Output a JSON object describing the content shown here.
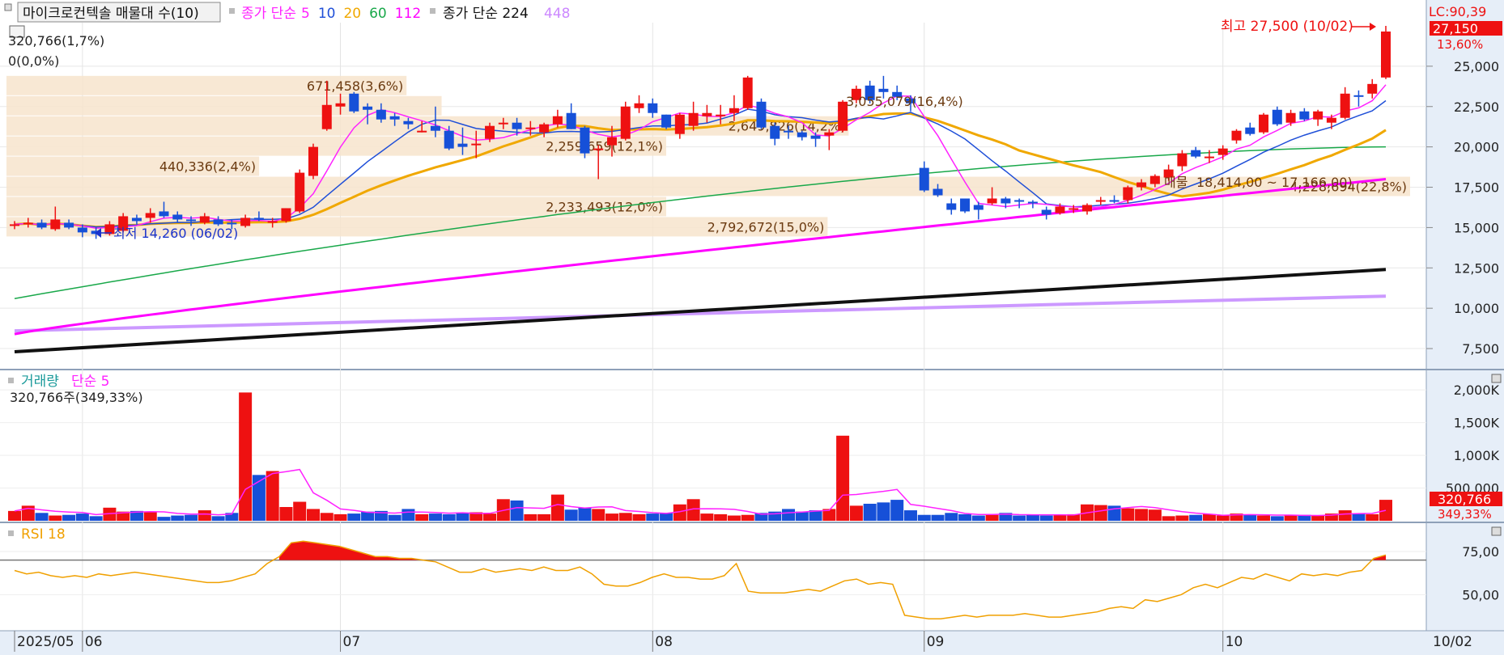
{
  "header": {
    "title": "마이크로컨텍솔 매물대 수(10)",
    "ma_label": "종가 단순",
    "ma_periods": [
      {
        "p": "5",
        "color": "#ff22ff"
      },
      {
        "p": "10",
        "color": "#1f4fd8"
      },
      {
        "p": "20",
        "color": "#f0a800"
      },
      {
        "p": "60",
        "color": "#19a84a"
      },
      {
        "p": "112",
        "color": "#ff00ff"
      }
    ],
    "ma2_label": "종가 단순 224",
    "ma2_extra": "448"
  },
  "price_panel": {
    "right_badges": {
      "lc": "LC:90,39",
      "last": "27,150",
      "pct": "13,60%"
    },
    "high_label": "최고 27,500 (10/02)",
    "low_label": "최저 14,260 (06/02)",
    "first_zone_labels": [
      "320,766(1,7%)",
      "0(0,0%)"
    ],
    "y_ticks": [
      {
        "v": 25000,
        "label": "25,000"
      },
      {
        "v": 22500,
        "label": "22,500"
      },
      {
        "v": 20000,
        "label": "20,000"
      },
      {
        "v": 17500,
        "label": "17,500"
      },
      {
        "v": 15000,
        "label": "15,000"
      },
      {
        "v": 12500,
        "label": "12,500"
      },
      {
        "v": 10000,
        "label": "10,000"
      },
      {
        "v": 7500,
        "label": "7,500"
      }
    ],
    "volume_zones": [
      {
        "lo": 23200,
        "hi": 24400,
        "len": 0.285,
        "label": "671,458(3,6%)"
      },
      {
        "lo": 21950,
        "hi": 23150,
        "len": 0.31,
        "label": ""
      },
      {
        "lo": 20700,
        "hi": 21900,
        "len": 0.6,
        "label": "2,649,826(14,2%)"
      },
      {
        "lo": 19450,
        "hi": 20650,
        "len": 0.47,
        "label": "2,259,659(12,1%)"
      },
      {
        "lo": 18200,
        "hi": 19400,
        "len": 0.18,
        "label": "440,336(2,4%)"
      },
      {
        "lo": 16950,
        "hi": 18150,
        "len": 1.0,
        "label": "4,228,694(22,8%)"
      },
      {
        "lo": 15700,
        "hi": 16900,
        "len": 0.47,
        "label": "2,233,493(12,0%)"
      },
      {
        "lo": 14450,
        "hi": 15650,
        "len": 0.585,
        "label": "2,792,672(15,0%)"
      }
    ],
    "zone_top_label": "3,055,079(16,4%)",
    "zone_top_value": 22800,
    "range_label": "18,414,00 ~ 17,166,00)",
    "range_prefix": "매물"
  },
  "x_axis": {
    "labels": [
      {
        "i": 0,
        "label": "2025/05"
      },
      {
        "i": 5,
        "label": "06"
      },
      {
        "i": 24,
        "label": "07"
      },
      {
        "i": 47,
        "label": "08"
      },
      {
        "i": 67,
        "label": "09"
      },
      {
        "i": 89,
        "label": "10"
      }
    ],
    "right_label": "10/02"
  },
  "volume_panel": {
    "title": "거래량",
    "ma_label": "단순 5",
    "value_label": "320,766주(349,33%)",
    "badge_value": "320,766",
    "badge_pct": "349,33%",
    "y_ticks": [
      {
        "v": 2000000,
        "label": "2,000K"
      },
      {
        "v": 1500000,
        "label": "1,500K"
      },
      {
        "v": 1000000,
        "label": "1,000K"
      },
      {
        "v": 500000,
        "label": "500,000"
      }
    ]
  },
  "rsi_panel": {
    "title": "RSI 18",
    "threshold": 70,
    "y_ticks": [
      {
        "v": 75,
        "label": "75,00"
      },
      {
        "v": 50,
        "label": "50,00"
      }
    ]
  },
  "chart_data": {
    "type": "candlestick",
    "title": "마이크로컨텍솔 매물대 수(10)",
    "ylim": [
      6300,
      27600
    ],
    "ohlc": [
      [
        15100,
        15400,
        14900,
        15200
      ],
      [
        15200,
        15600,
        15000,
        15300
      ],
      [
        15300,
        15500,
        14900,
        15000
      ],
      [
        14900,
        16300,
        14800,
        15500
      ],
      [
        15300,
        15500,
        14900,
        15000
      ],
      [
        15000,
        15200,
        14400,
        14700
      ],
      [
        14800,
        15000,
        14300,
        14600
      ],
      [
        14600,
        15400,
        14500,
        15200
      ],
      [
        14800,
        15900,
        14700,
        15700
      ],
      [
        15600,
        15800,
        15200,
        15400
      ],
      [
        15600,
        16200,
        15300,
        15900
      ],
      [
        16000,
        16600,
        15600,
        15700
      ],
      [
        15800,
        16000,
        15300,
        15500
      ],
      [
        15500,
        15700,
        15100,
        15400
      ],
      [
        15300,
        15900,
        15200,
        15700
      ],
      [
        15500,
        15700,
        15100,
        15200
      ],
      [
        15300,
        15500,
        14900,
        15200
      ],
      [
        15100,
        15800,
        15000,
        15600
      ],
      [
        15600,
        16000,
        15400,
        15500
      ],
      [
        15300,
        15600,
        15000,
        15400
      ],
      [
        15400,
        16200,
        15300,
        16200
      ],
      [
        16000,
        18600,
        15900,
        18400
      ],
      [
        18200,
        20200,
        18000,
        20000
      ],
      [
        21100,
        24100,
        21000,
        22600
      ],
      [
        22500,
        23300,
        22000,
        22700
      ],
      [
        23300,
        23400,
        22100,
        22200
      ],
      [
        22500,
        22700,
        21400,
        22300
      ],
      [
        22300,
        22700,
        21500,
        21700
      ],
      [
        21900,
        22100,
        21300,
        21700
      ],
      [
        21600,
        21800,
        21100,
        21400
      ],
      [
        21000,
        21600,
        20900,
        21000
      ],
      [
        21300,
        22500,
        20600,
        21000
      ],
      [
        21000,
        21300,
        19800,
        19900
      ],
      [
        20200,
        21200,
        19500,
        20000
      ],
      [
        20200,
        21000,
        19300,
        20200
      ],
      [
        20500,
        21500,
        20300,
        21300
      ],
      [
        21500,
        21800,
        21100,
        21500
      ],
      [
        21500,
        21800,
        20700,
        21100
      ],
      [
        21100,
        21600,
        20700,
        21200
      ],
      [
        20900,
        21500,
        20600,
        21400
      ],
      [
        21400,
        22300,
        21200,
        21900
      ],
      [
        22100,
        22700,
        21100,
        21100
      ],
      [
        21200,
        21300,
        19300,
        19600
      ],
      [
        19800,
        20100,
        18000,
        19900
      ],
      [
        20100,
        21300,
        19400,
        20600
      ],
      [
        20500,
        22800,
        20400,
        22500
      ],
      [
        22400,
        23200,
        22100,
        22700
      ],
      [
        22700,
        23000,
        21800,
        22100
      ],
      [
        22000,
        22000,
        21100,
        21200
      ],
      [
        20800,
        22100,
        20500,
        22000
      ],
      [
        21300,
        22800,
        21000,
        22100
      ],
      [
        21900,
        22600,
        21500,
        22100
      ],
      [
        21900,
        22600,
        21400,
        22000
      ],
      [
        22100,
        23200,
        21600,
        22400
      ],
      [
        22400,
        24400,
        22300,
        24300
      ],
      [
        22800,
        23000,
        21100,
        21200
      ],
      [
        21300,
        21500,
        20100,
        20500
      ],
      [
        21000,
        21300,
        20500,
        20900
      ],
      [
        20900,
        21000,
        20400,
        20600
      ],
      [
        20700,
        20900,
        20000,
        20500
      ],
      [
        20700,
        21100,
        19800,
        20900
      ],
      [
        21000,
        22900,
        20900,
        22800
      ],
      [
        22900,
        23800,
        22700,
        23600
      ],
      [
        23800,
        24100,
        22700,
        22900
      ],
      [
        23600,
        24400,
        23000,
        23400
      ],
      [
        23400,
        23800,
        22900,
        23100
      ],
      [
        23000,
        23200,
        22200,
        22700
      ],
      [
        18700,
        19100,
        17200,
        17300
      ],
      [
        17400,
        17700,
        16900,
        17000
      ],
      [
        16500,
        16800,
        15800,
        16100
      ],
      [
        16800,
        16800,
        15900,
        16000
      ],
      [
        16400,
        16600,
        15500,
        16100
      ],
      [
        16500,
        17500,
        16400,
        16800
      ],
      [
        16800,
        16900,
        16200,
        16500
      ],
      [
        16700,
        16800,
        16200,
        16600
      ],
      [
        16600,
        16700,
        16200,
        16500
      ],
      [
        16100,
        16300,
        15500,
        15800
      ],
      [
        15900,
        16500,
        15800,
        16300
      ],
      [
        16200,
        16400,
        15900,
        16200
      ],
      [
        16000,
        16500,
        15800,
        16400
      ],
      [
        16600,
        16900,
        16400,
        16700
      ],
      [
        16700,
        17000,
        16500,
        16600
      ],
      [
        16700,
        17600,
        16500,
        17500
      ],
      [
        17500,
        18000,
        17300,
        17800
      ],
      [
        17700,
        18300,
        17500,
        18200
      ],
      [
        18100,
        18900,
        17900,
        18600
      ],
      [
        18800,
        19800,
        18500,
        19600
      ],
      [
        19800,
        20000,
        19300,
        19400
      ],
      [
        19300,
        19800,
        19000,
        19400
      ],
      [
        19500,
        20100,
        19200,
        19900
      ],
      [
        20400,
        21100,
        20200,
        21000
      ],
      [
        21200,
        21500,
        20700,
        20800
      ],
      [
        20900,
        22100,
        20800,
        22000
      ],
      [
        22300,
        22500,
        21300,
        21400
      ],
      [
        21500,
        22300,
        21300,
        22100
      ],
      [
        22200,
        22400,
        21600,
        21700
      ],
      [
        21700,
        22300,
        21300,
        22200
      ],
      [
        21500,
        22000,
        21100,
        21800
      ],
      [
        21800,
        23700,
        21700,
        23300
      ],
      [
        23200,
        23500,
        22500,
        23100
      ],
      [
        23300,
        24200,
        23000,
        23900
      ],
      [
        24300,
        27500,
        24200,
        27150
      ]
    ],
    "volume": [
      150,
      230,
      120,
      80,
      90,
      110,
      70,
      200,
      140,
      150,
      130,
      60,
      80,
      90,
      160,
      70,
      120,
      1960,
      700,
      760,
      210,
      290,
      180,
      120,
      100,
      110,
      140,
      150,
      90,
      180,
      100,
      110,
      100,
      120,
      130,
      110,
      330,
      310,
      100,
      100,
      400,
      170,
      200,
      180,
      110,
      120,
      100,
      110,
      120,
      250,
      330,
      110,
      100,
      80,
      90,
      120,
      140,
      180,
      140,
      160,
      180,
      1300,
      230,
      260,
      280,
      320,
      160,
      90,
      90,
      120,
      100,
      80,
      90,
      120,
      80,
      90,
      80,
      90,
      100,
      250,
      240,
      230,
      190,
      180,
      170,
      70,
      80,
      90,
      100,
      80,
      110,
      90,
      80,
      70,
      80,
      90,
      80,
      110,
      160,
      110,
      100,
      320
    ],
    "volume_unit": "K",
    "rsi": [
      64,
      62,
      63,
      61,
      60,
      61,
      60,
      62,
      61,
      62,
      63,
      62,
      61,
      60,
      59,
      58,
      57,
      57,
      58,
      60,
      62,
      68,
      72,
      80,
      81,
      80,
      79,
      78,
      76,
      74,
      72,
      72,
      71,
      71,
      70,
      69,
      66,
      63,
      63,
      65,
      63,
      64,
      65,
      64,
      66,
      64,
      64,
      66,
      62,
      56,
      55,
      55,
      57,
      60,
      62,
      60,
      60,
      59,
      59,
      61,
      68,
      52,
      51,
      51,
      51,
      52,
      53,
      52,
      55,
      58,
      59,
      56,
      57,
      56,
      38,
      37,
      36,
      36,
      37,
      38,
      37,
      38,
      38,
      38,
      39,
      38,
      37,
      37,
      38,
      39,
      40,
      42,
      43,
      42,
      47,
      46,
      48,
      50,
      54,
      56,
      54,
      57,
      60,
      59,
      62,
      60,
      58,
      62,
      61,
      62,
      61,
      63,
      64,
      71,
      73
    ]
  }
}
